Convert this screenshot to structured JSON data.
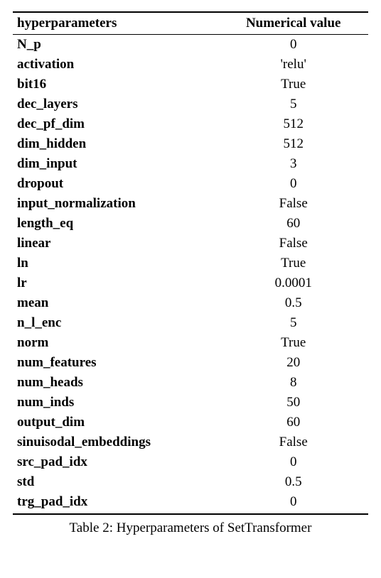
{
  "chart_data": {
    "type": "table",
    "title": "Hyperparameters of SetTransformer",
    "columns": [
      "hyperparameters",
      "Numerical value"
    ],
    "rows": [
      [
        "N_p",
        "0"
      ],
      [
        "activation",
        "'relu'"
      ],
      [
        "bit16",
        "True"
      ],
      [
        "dec_layers",
        "5"
      ],
      [
        "dec_pf_dim",
        "512"
      ],
      [
        "dim_hidden",
        "512"
      ],
      [
        "dim_input",
        "3"
      ],
      [
        "dropout",
        "0"
      ],
      [
        "input_normalization",
        "False"
      ],
      [
        "length_eq",
        "60"
      ],
      [
        "linear",
        "False"
      ],
      [
        "ln",
        "True"
      ],
      [
        "lr",
        "0.0001"
      ],
      [
        "mean",
        "0.5"
      ],
      [
        "n_l_enc",
        "5"
      ],
      [
        "norm",
        "True"
      ],
      [
        "num_features",
        "20"
      ],
      [
        "num_heads",
        "8"
      ],
      [
        "num_inds",
        "50"
      ],
      [
        "output_dim",
        "60"
      ],
      [
        "sinuisodal_embeddings",
        "False"
      ],
      [
        "src_pad_idx",
        "0"
      ],
      [
        "std",
        "0.5"
      ],
      [
        "trg_pad_idx",
        "0"
      ]
    ]
  },
  "caption_prefix": "Table 2: ",
  "caption_text": "Hyperparameters of SetTransformer"
}
